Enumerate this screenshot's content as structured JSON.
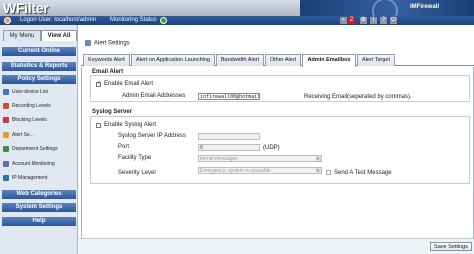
{
  "app": {
    "logo": "WFilter",
    "banner_title": "IMFirewall"
  },
  "statusbar": {
    "logon": "Logon User: localhost/admin",
    "monitoring": "Monitoring Status",
    "badge_count": "2"
  },
  "sidebar": {
    "tabs": [
      "My Menu",
      "View All"
    ],
    "sections": {
      "current_online": "Current Online",
      "statistics": "Statistics & Reports",
      "policy": "Policy Settings",
      "web_categories": "Web Categories",
      "system": "System Settings",
      "help": "Help"
    },
    "items": [
      {
        "label": "User-device List",
        "icon": "user-list-icon",
        "color": "#3a77c9"
      },
      {
        "label": "Recording Levels",
        "icon": "record-icon",
        "color": "#d94a2b"
      },
      {
        "label": "Blocking Levels",
        "icon": "block-icon",
        "color": "#c23b3b"
      },
      {
        "label": "Alert Se...",
        "icon": "alert-icon",
        "color": "#e0a12a"
      },
      {
        "label": "Department Settings",
        "icon": "department-icon",
        "color": "#3f8f4a"
      },
      {
        "label": "Account Monitoring",
        "icon": "account-icon",
        "color": "#5a6fb0"
      },
      {
        "label": "IP Management",
        "icon": "ip-icon",
        "color": "#2c6fb8"
      }
    ]
  },
  "main": {
    "breadcrumb": "Alert Settings",
    "tabs": [
      "Keywords Alert",
      "Alert on Application Launching",
      "Bandwidth Alert",
      "Other Alert",
      "Admin Emailbox",
      "Alert Target"
    ],
    "active_tab": "Admin Emailbox",
    "email_alert": {
      "title": "Email Alert",
      "enable_label": "Enable Email Alert",
      "enable_checked": true,
      "address_label": "Admin Email Addresses",
      "address_value": "infirewall00@hotmail.",
      "address_hint": "Receiving Email(seperated by commas)."
    },
    "syslog": {
      "title": "Syslog Server",
      "enable_label": "Enable Syslog Alert",
      "enable_checked": false,
      "ip_label": "Syslog Server IP Address",
      "ip_value": "",
      "port_label": "Port",
      "port_value": "0",
      "port_suffix": "(UDP)",
      "facility_label": "Facility Type",
      "facility_value": "kernel messages",
      "severity_label": "Severity Level",
      "severity_value": "Emergency: system is unusable",
      "send_test_label": "Send A Test Message"
    },
    "save_button": "Save Settings"
  }
}
